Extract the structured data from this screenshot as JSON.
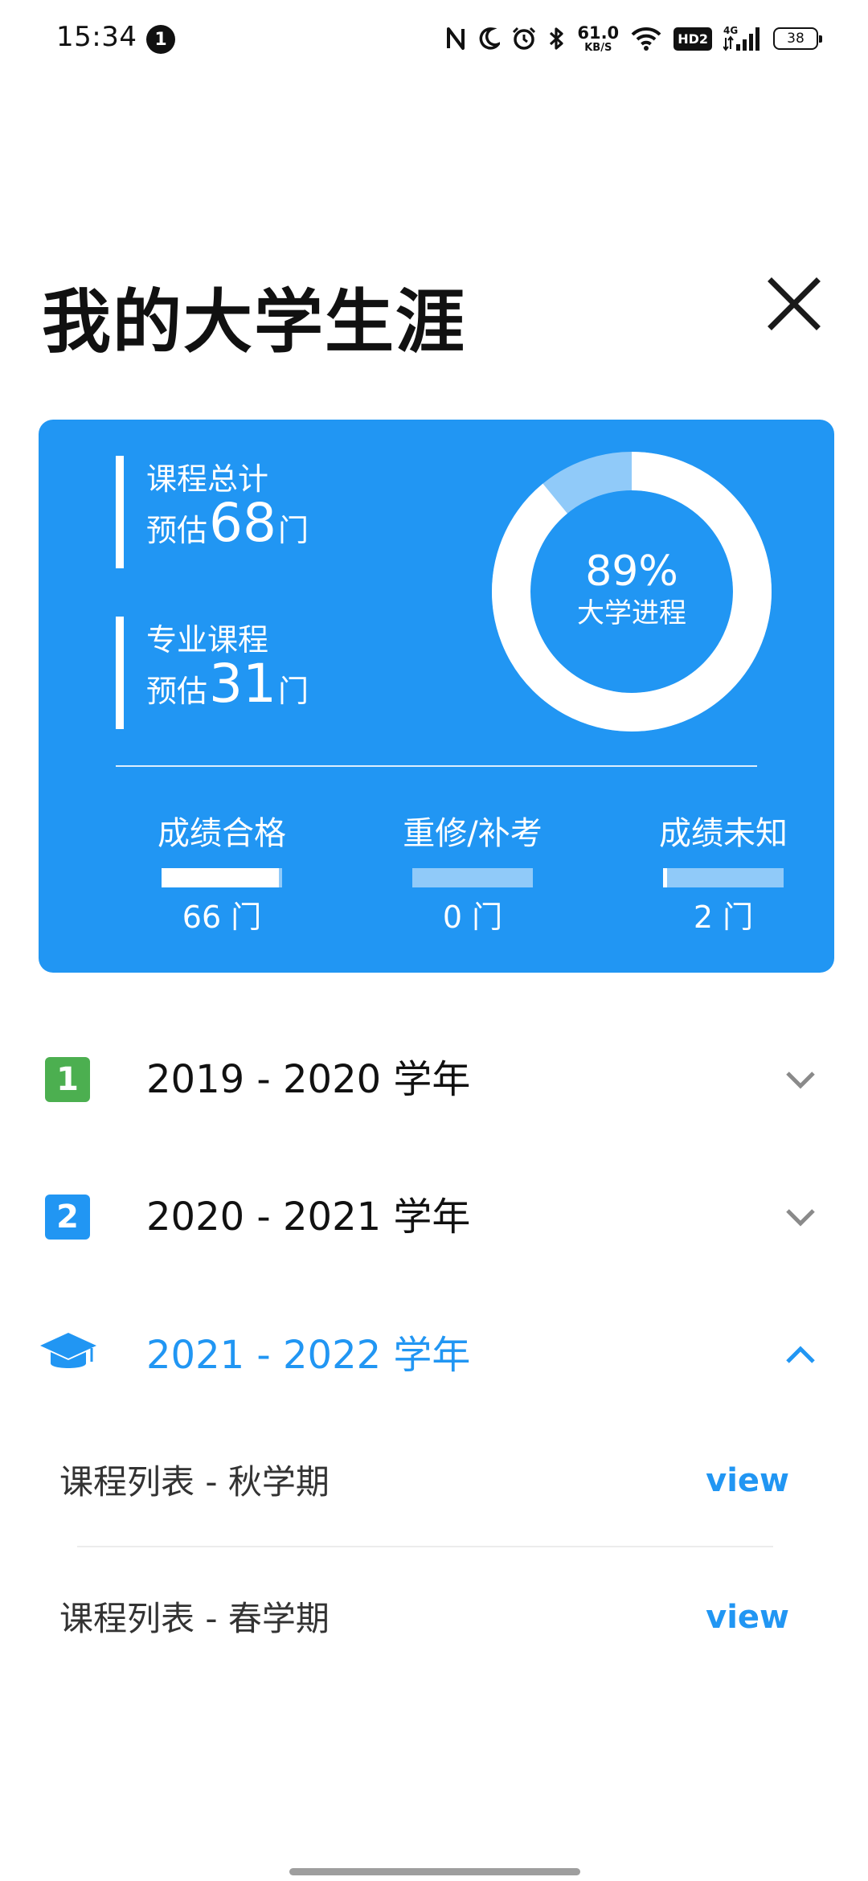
{
  "status_bar": {
    "time": "15:34",
    "notification_count": "1",
    "net_speed_value": "61.0",
    "net_speed_unit": "KB/S",
    "hd_label": "HD2",
    "network_label": "4G",
    "battery": "38",
    "icons": [
      "nfc-icon",
      "moon-icon",
      "alarm-icon",
      "bluetooth-icon",
      "wifi-icon",
      "signal-icon",
      "battery-icon"
    ]
  },
  "header": {
    "title": "我的大学生涯",
    "close_icon": "close-icon"
  },
  "summary": {
    "total": {
      "label": "课程总计",
      "prefix": "预估",
      "count": "68",
      "unit": "门"
    },
    "major": {
      "label": "专业课程",
      "prefix": "预估",
      "count": "31",
      "unit": "门"
    },
    "progress": {
      "percent_text": "89%",
      "caption": "大学进程",
      "value": 0.89
    },
    "grades": [
      {
        "label": "成绩合格",
        "count_text": "66 门",
        "fill": 0.97
      },
      {
        "label": "重修/补考",
        "count_text": "0 门",
        "fill": 0.0
      },
      {
        "label": "成绩未知",
        "count_text": "2 门",
        "fill": 0.03
      }
    ]
  },
  "years": [
    {
      "badge": "1",
      "label": "2019 - 2020 学年",
      "expanded": false,
      "icon": "number-one-icon"
    },
    {
      "badge": "2",
      "label": "2020 - 2021 学年",
      "expanded": false,
      "icon": "number-two-icon"
    },
    {
      "badge": "",
      "label": "2021 - 2022 学年",
      "expanded": true,
      "icon": "graduation-cap-icon"
    }
  ],
  "semesters": [
    {
      "label": "课程列表 - 秋学期",
      "link": "view"
    },
    {
      "label": "课程列表 - 春学期",
      "link": "view"
    }
  ],
  "colors": {
    "primary": "#2196F3",
    "primary_light": "#90CAF9",
    "green": "#4CAF50",
    "text_dark": "#111111"
  }
}
